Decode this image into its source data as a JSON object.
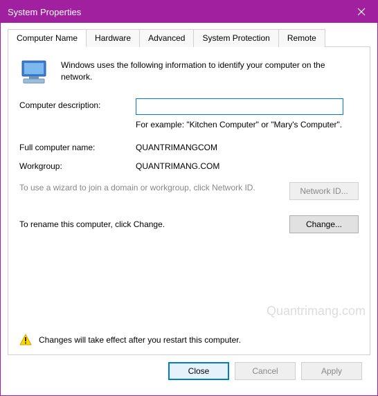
{
  "titlebar": {
    "title": "System Properties"
  },
  "tabs": {
    "items": [
      {
        "label": "Computer Name",
        "active": true
      },
      {
        "label": "Hardware"
      },
      {
        "label": "Advanced"
      },
      {
        "label": "System Protection"
      },
      {
        "label": "Remote"
      }
    ]
  },
  "intro": "Windows uses the following information to identify your computer on the network.",
  "description": {
    "label": "Computer description:",
    "value": "",
    "example": "For example: \"Kitchen Computer\" or \"Mary's Computer\"."
  },
  "full_name": {
    "label": "Full computer name:",
    "value": "QUANTRIMANGCOM"
  },
  "workgroup": {
    "label": "Workgroup:",
    "value": "QUANTRIMANG.COM"
  },
  "wizard": {
    "text": "To use a wizard to join a domain or workgroup, click Network ID.",
    "button": "Network ID..."
  },
  "rename": {
    "text": "To rename this computer, click Change.",
    "button": "Change..."
  },
  "warning": "Changes will take effect after you restart this computer.",
  "footer": {
    "close": "Close",
    "cancel": "Cancel",
    "apply": "Apply"
  },
  "watermark": "Quantrimang.com"
}
